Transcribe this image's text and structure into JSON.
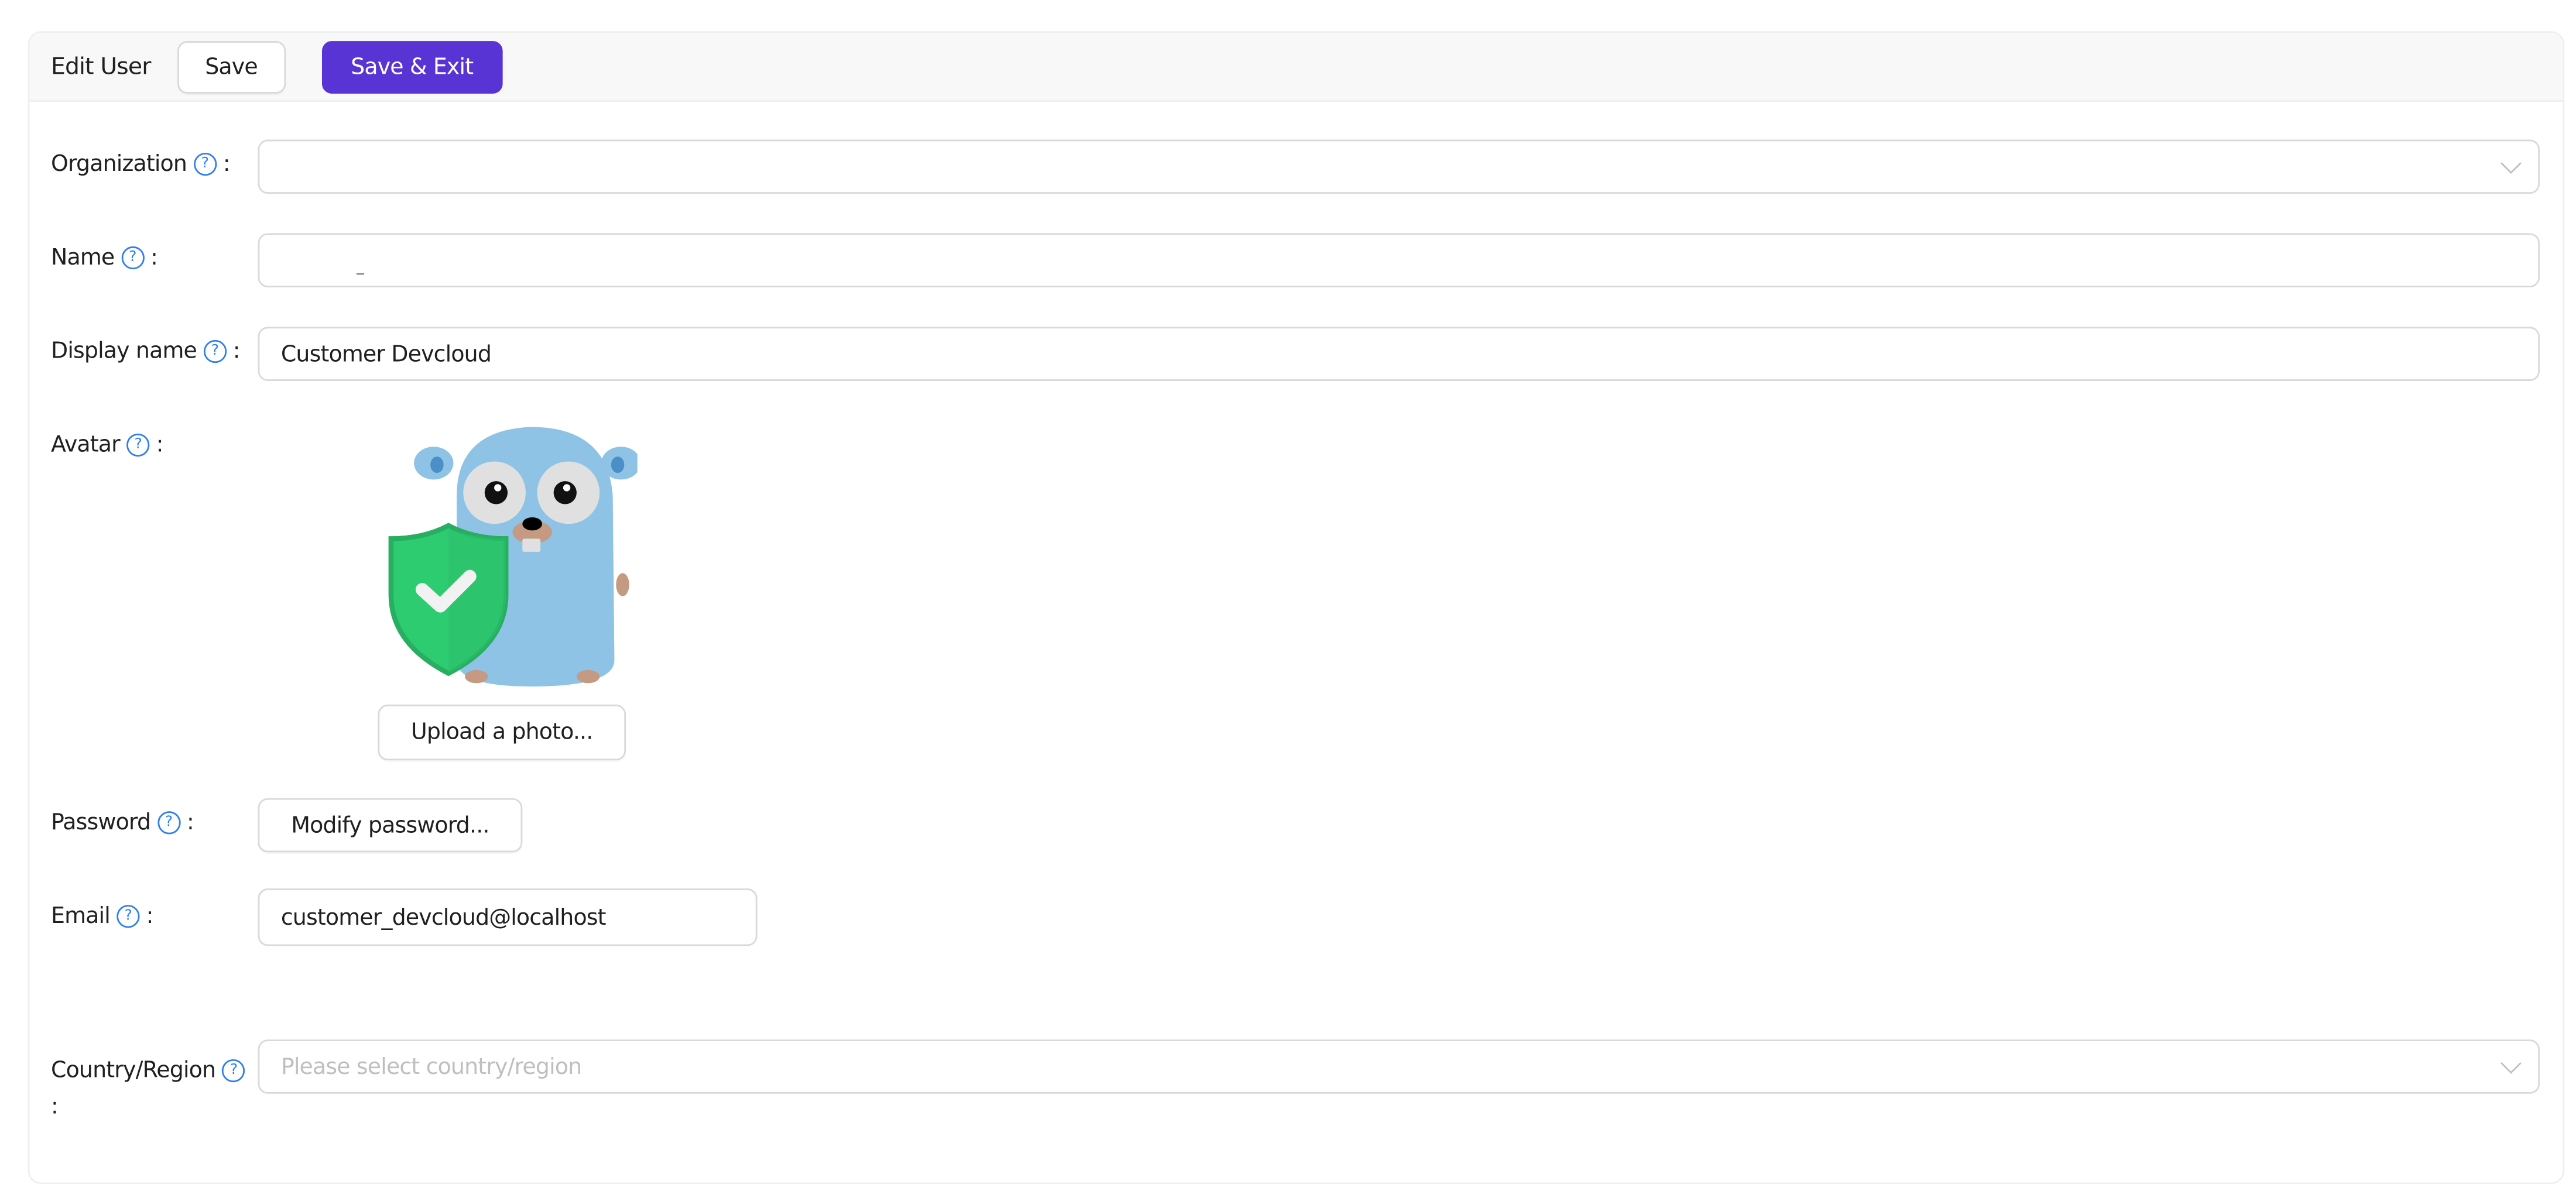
{
  "header": {
    "title": "Edit User",
    "save_label": "Save",
    "save_exit_label": "Save & Exit"
  },
  "colors": {
    "primary": "#5734d3",
    "help_icon": "#2f80ed"
  },
  "form": {
    "organization": {
      "label": "Organization",
      "colon": ":",
      "value": "",
      "icon": "question-circle-icon"
    },
    "name": {
      "label": "Name",
      "colon": ":",
      "value": "                  _",
      "icon": "question-circle-icon"
    },
    "display_name": {
      "label": "Display name",
      "colon": ":",
      "value": "Customer Devcloud",
      "icon": "question-circle-icon"
    },
    "avatar": {
      "label": "Avatar",
      "colon": ":",
      "upload_label": "Upload a photo...",
      "icon": "question-circle-icon"
    },
    "password": {
      "label": "Password",
      "colon": ":",
      "button_label": "Modify password...",
      "icon": "question-circle-icon"
    },
    "email": {
      "label": "Email",
      "colon": ":",
      "value": "customer_devcloud@localhost",
      "icon": "question-circle-icon"
    },
    "country_region": {
      "label": "Country/Region",
      "colon": ":",
      "placeholder": "Please select country/region",
      "icon": "question-circle-icon"
    }
  }
}
